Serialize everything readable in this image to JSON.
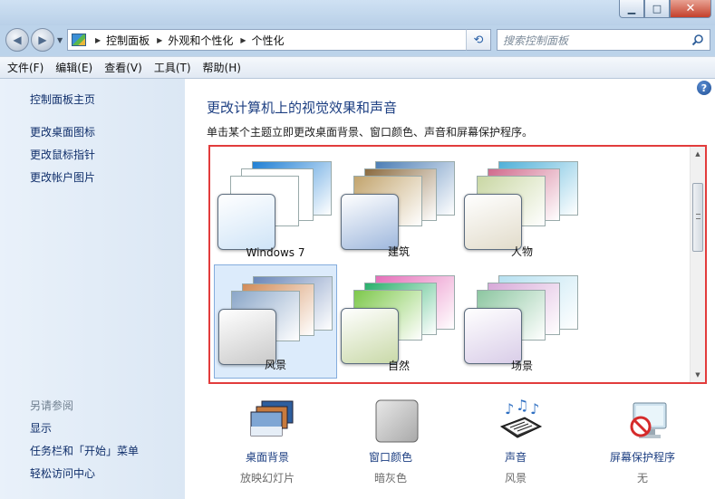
{
  "titlebar": {
    "minimize": "▁",
    "maximize": "□",
    "close": "✕"
  },
  "nav": {
    "breadcrumb": [
      "控制面板",
      "外观和个性化",
      "个性化"
    ],
    "search_placeholder": "搜索控制面板"
  },
  "menu": [
    "文件(F)",
    "编辑(E)",
    "查看(V)",
    "工具(T)",
    "帮助(H)"
  ],
  "left": {
    "links": [
      "控制面板主页",
      "更改桌面图标",
      "更改鼠标指针",
      "更改帐户图片"
    ],
    "see_also_label": "另请参阅",
    "see_also": [
      "显示",
      "任务栏和「开始」菜单",
      "轻松访问中心"
    ]
  },
  "main": {
    "title": "更改计算机上的视觉效果和声音",
    "description": "单击某个主题立即更改桌面背景、窗口颜色、声音和屏幕保护程序。",
    "themes": [
      {
        "name": "Windows 7",
        "colors": [
          "#1f7fd4",
          "#ffffff",
          "#ffffff"
        ],
        "glass": "#cfe4f7"
      },
      {
        "name": "建筑",
        "colors": [
          "#4d7eb5",
          "#8a6a3f",
          "#c2a46d"
        ],
        "glass": "#9fb8dd"
      },
      {
        "name": "人物",
        "colors": [
          "#4fb0d8",
          "#d06a8c",
          "#c9d7a3"
        ],
        "glass": "#e2dccb"
      },
      {
        "name": "风景",
        "colors": [
          "#6a86b8",
          "#d28b57",
          "#8aa6c8"
        ],
        "glass": "#c9c9c9"
      },
      {
        "name": "自然",
        "colors": [
          "#e56fb9",
          "#28b06b",
          "#7dc84b"
        ],
        "glass": "#c9d9a8"
      },
      {
        "name": "场景",
        "colors": [
          "#b6e0f0",
          "#d7a8d8",
          "#8cc6a0"
        ],
        "glass": "#d9cde8"
      }
    ],
    "selected_theme": "风景",
    "tiles": [
      {
        "label": "桌面背景",
        "value": "放映幻灯片",
        "icon": "desktop-background-icon"
      },
      {
        "label": "窗口颜色",
        "value": "暗灰色",
        "icon": "window-color-icon"
      },
      {
        "label": "声音",
        "value": "风景",
        "icon": "sound-icon"
      },
      {
        "label": "屏幕保护程序",
        "value": "无",
        "icon": "screensaver-icon"
      }
    ]
  },
  "colors": {
    "link": "#1d3f82",
    "highlight_border": "#e23c3c",
    "selected_bg": "#dcebfb"
  }
}
